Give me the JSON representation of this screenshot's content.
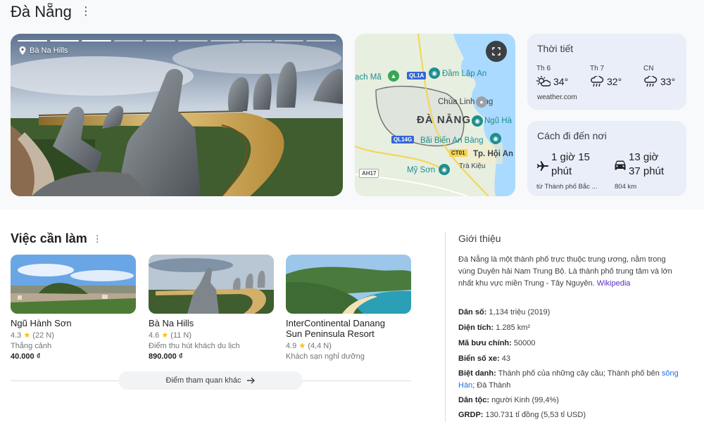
{
  "header": {
    "title": "Đà Nẵng"
  },
  "photo": {
    "location_label": "Bà Na Hills",
    "slides": 10,
    "active_slide": 3
  },
  "map": {
    "labels": {
      "rach_ma": "ạch Mã",
      "dam_lap_an": "Đầm Lập An",
      "chua_linh_ung": "Chùa Linh Ứng",
      "da_nang": "ĐÀ NẴNG",
      "ngu_ha": "Ngũ Hà",
      "bai_bien": "Bãi Biển An Bàng",
      "hoi_an": "Tp. Hội An",
      "my_son": "Mỹ Sơn",
      "tra_kieu": "Trà Kiệu"
    },
    "roads": {
      "ql1a": "QL1A",
      "ql14g": "QL14G",
      "ct01": "CT01",
      "ah17": "AH17"
    }
  },
  "weather": {
    "title": "Thời tiết",
    "days": [
      {
        "day": "Th 6",
        "temp": "34°",
        "icon": "partly-sunny-icon"
      },
      {
        "day": "Th 7",
        "temp": "32°",
        "icon": "rain-icon"
      },
      {
        "day": "CN",
        "temp": "33°",
        "icon": "rain-icon"
      }
    ],
    "source": "weather.com"
  },
  "travel": {
    "title": "Cách đi đến nơi",
    "flight": {
      "time_line1": "1 giờ 15",
      "time_line2": "phút",
      "sub": "từ Thành phố Bắc ..."
    },
    "car": {
      "time_line1": "13 giờ",
      "time_line2": "37 phút",
      "sub": "804 km"
    }
  },
  "things": {
    "title": "Việc cần làm",
    "items": [
      {
        "name_line1": "Ngũ Hành Sơn",
        "name_line2": "",
        "rating": "4.3",
        "reviews": "(22 N)",
        "category": "Thắng cảnh",
        "price": "40.000 ₫"
      },
      {
        "name_line1": "Bà Na Hills",
        "name_line2": "",
        "rating": "4.6",
        "reviews": "(11 N)",
        "category": "Điểm thu hút khách du lịch",
        "price": "890.000 ₫"
      },
      {
        "name_line1": "InterContinental Danang",
        "name_line2": "Sun Peninsula Resort",
        "rating": "4.9",
        "reviews": "(4,4 N)",
        "category": "Khách sạn nghỉ dưỡng",
        "price": ""
      }
    ],
    "more_label": "Điểm tham quan khác"
  },
  "about": {
    "title": "Giới thiệu",
    "description": "Đà Nẵng là một thành phố trực thuộc trung ương, nằm trong vùng Duyên hải Nam Trung Bộ. Là thành phố trung tâm và lớn nhất khu vực miền Trung - Tây Nguyên.",
    "source_link": "Wikipedia",
    "facts": {
      "population": {
        "label": "Dân số:",
        "value": "1,134 triệu (2019)"
      },
      "area": {
        "label": "Diện tích:",
        "value": "1.285 km²"
      },
      "postal": {
        "label": "Mã bưu chính:",
        "value": "50000"
      },
      "plate": {
        "label": "Biển số xe:",
        "value": "43"
      },
      "nickname": {
        "label": "Biệt danh:",
        "value_pre": "Thành phố của những cây cầu; Thành phố bên",
        "link": "sông Hàn",
        "value_post": "; Đà Thành"
      },
      "ethnic": {
        "label": "Dân tộc:",
        "value": "người Kinh (99,4%)"
      },
      "grdp": {
        "label": "GRDP:",
        "value": "130.731 tỉ đồng (5,53 tỉ USD)"
      }
    }
  }
}
